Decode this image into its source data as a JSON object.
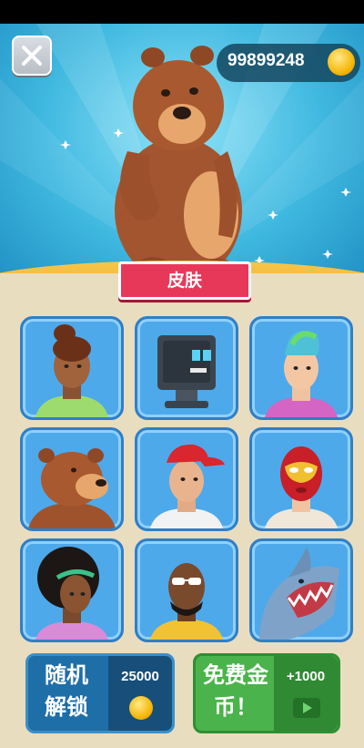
{
  "header": {
    "close_icon": "close-icon",
    "coins": "99899248",
    "coin_icon": "gold-coin-icon"
  },
  "banner": {
    "title": "皮肤"
  },
  "preview": {
    "character": "brown bear"
  },
  "skins": [
    {
      "name": "woman-bun"
    },
    {
      "name": "robot-monitor"
    },
    {
      "name": "punk-mohawk"
    },
    {
      "name": "bear"
    },
    {
      "name": "red-cap-man"
    },
    {
      "name": "luchador-mask"
    },
    {
      "name": "afro-headband"
    },
    {
      "name": "sunglasses-man"
    },
    {
      "name": "shark"
    }
  ],
  "buttons": {
    "random_unlock": {
      "label": "随机解锁",
      "line1": "随机",
      "line2": "解锁",
      "cost": "25000",
      "icon": "gold-coin-icon"
    },
    "free_coins": {
      "label": "免费金币！",
      "line1": "免费金",
      "line2": "币！",
      "reward": "+1000",
      "icon": "video-play-icon"
    }
  },
  "colors": {
    "sky": "#3fb8e0",
    "banner": "#e8385a",
    "tile": "#4ea9ea",
    "random": "#1e6ea8",
    "free": "#4ab34b"
  }
}
